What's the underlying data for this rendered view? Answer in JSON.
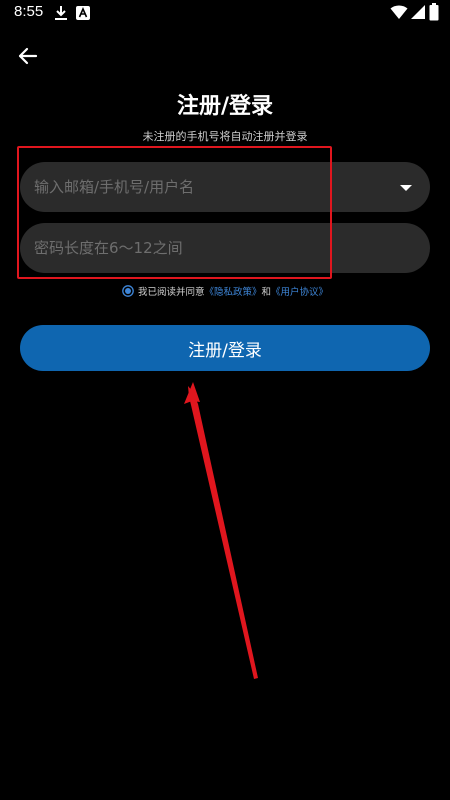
{
  "status_bar": {
    "time": "8:55",
    "icons": [
      "download-icon",
      "a-notification-icon",
      "wifi-icon",
      "signal-icon",
      "battery-icon"
    ]
  },
  "header": {
    "back_icon": "arrow-left-icon"
  },
  "page": {
    "title": "注册/登录",
    "subtitle": "未注册的手机号将自动注册并登录"
  },
  "form": {
    "account": {
      "value": "",
      "placeholder": "输入邮箱/手机号/用户名",
      "dropdown_icon": "triangle-down-icon"
    },
    "password": {
      "value": "",
      "placeholder": "密码长度在6～12之间"
    },
    "agreement": {
      "checked": true,
      "prefix": "我已阅读并同意",
      "privacy_link": "《隐私政策》",
      "and": "和",
      "user_link": "《用户协议》"
    },
    "submit_label": "注册/登录"
  },
  "colors": {
    "background": "#000000",
    "input_bg": "#2b2b2b",
    "primary_button": "#0f66b0",
    "link": "#3e86d8",
    "annotation": "#e0161e"
  }
}
